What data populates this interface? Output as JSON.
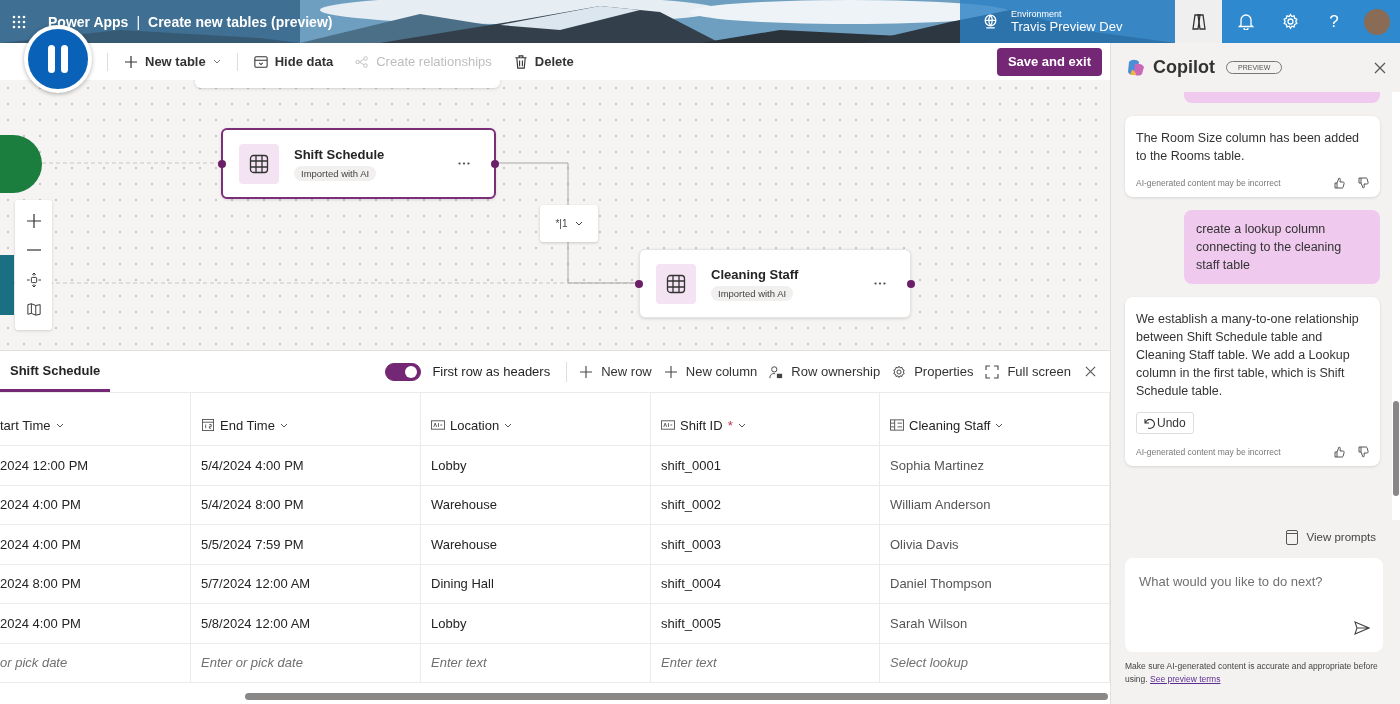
{
  "header": {
    "app_name": "Power Apps",
    "separator": "|",
    "page_title": "Create new tables (preview)",
    "environment_label": "Environment",
    "environment_name": "Travis Preview Dev",
    "help": "?"
  },
  "toolbar": {
    "items": [
      {
        "label": "New table",
        "dropdown": true,
        "disabled": false
      },
      {
        "label": "Hide data",
        "dropdown": false,
        "disabled": false
      },
      {
        "label": "Create relationships",
        "dropdown": false,
        "disabled": true
      },
      {
        "label": "Delete",
        "dropdown": false,
        "disabled": false
      }
    ],
    "primary_button": "Save and exit"
  },
  "canvas": {
    "nodes": [
      {
        "title": "Shift Schedule",
        "tag": "Imported with AI",
        "selected": true
      },
      {
        "title": "Cleaning Staff",
        "tag": "Imported with AI",
        "selected": false
      }
    ],
    "relationship": "*|1"
  },
  "table": {
    "tab": {
      "label": "Shift Schedule",
      "selected": true
    },
    "header_toggle": {
      "label": "First row as headers",
      "on": true
    },
    "actions": [
      "New row",
      "New column",
      "Row ownership",
      "Properties",
      "Full screen"
    ],
    "columns": [
      {
        "label": "tart Time"
      },
      {
        "label": "End Time",
        "kind": "datetime"
      },
      {
        "label": "Location",
        "kind": "text"
      },
      {
        "label": "Shift ID",
        "kind": "text",
        "required_mark": "*"
      },
      {
        "label": "Cleaning Staff",
        "kind": "lookup"
      }
    ],
    "rows": [
      [
        "2024 12:00 PM",
        "5/4/2024 4:00 PM",
        "Lobby",
        "shift_0001",
        "Sophia Martinez"
      ],
      [
        "2024 4:00 PM",
        "5/4/2024 8:00 PM",
        "Warehouse",
        "shift_0002",
        "William Anderson"
      ],
      [
        "2024 4:00 PM",
        "5/5/2024 7:59 PM",
        "Warehouse",
        "shift_0003",
        "Olivia Davis"
      ],
      [
        "2024 8:00 PM",
        "5/7/2024 12:00 AM",
        "Dining Hall",
        "shift_0004",
        "Daniel Thompson"
      ],
      [
        "2024 4:00 PM",
        "5/8/2024 12:00 AM",
        "Lobby",
        "shift_0005",
        "Sarah Wilson"
      ]
    ],
    "new_row_placeholders": [
      "or pick date",
      "Enter or pick date",
      "Enter text",
      "Enter text",
      "Select lookup"
    ]
  },
  "copilot": {
    "title": "Copilot",
    "badge": "PREVIEW",
    "messages": [
      {
        "kind": "assistant",
        "text": "The Room Size column has been added to the Rooms table.",
        "note": "AI-generated content may be incorrect"
      },
      {
        "kind": "user",
        "text": "create a lookup column connecting to the cleaning staff table"
      },
      {
        "kind": "assistant",
        "text": "We establish a many-to-one relationship between Shift Schedule table and Cleaning Staff table. We add a Lookup column in the first table, which is Shift Schedule table.",
        "action": "Undo",
        "note": "AI-generated content may be incorrect"
      }
    ],
    "view_prompts": "View prompts",
    "input_placeholder": "What would you like to do next?",
    "disclaimer": "Make sure AI-generated content is accurate and appropriate before using.",
    "disclaimer_link": "See preview terms"
  }
}
